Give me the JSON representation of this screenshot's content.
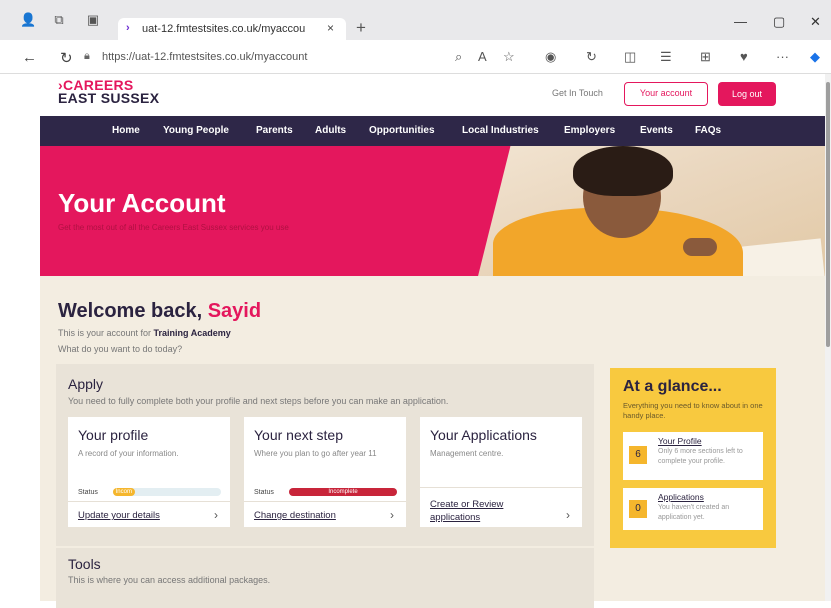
{
  "browser": {
    "tab_title": "uat-12.fmtestsites.co.uk/myaccou",
    "url": "https://uat-12.fmtestsites.co.uk/myaccount",
    "new_tab_glyph": "+",
    "close_glyph": "×",
    "minimize_glyph": "—",
    "restore_glyph": "▢",
    "window_close_glyph": "✕",
    "back_glyph": "←",
    "refresh_glyph": "↻",
    "more_glyph": "···"
  },
  "header": {
    "logo_line1": "›CAREERS",
    "logo_line2": "EAST SUSSEX",
    "get_in_touch": "Get In Touch",
    "your_account": "Your account",
    "log_out": "Log out"
  },
  "nav": {
    "items": [
      "Home",
      "Young People",
      "Parents",
      "Adults",
      "Opportunities",
      "Local Industries",
      "Employers",
      "Events",
      "FAQs"
    ]
  },
  "hero": {
    "title": "Your Account",
    "subtitle": "Get the most out of all the Careers East Sussex services you use"
  },
  "welcome": {
    "prefix": "Welcome back, ",
    "name": "Sayid",
    "account_prefix": "This is your account for ",
    "account_org": "Training Academy",
    "question": "What do you want to do today?"
  },
  "apply": {
    "title": "Apply",
    "description": "You need to fully complete both your profile and next steps before you can make an application.",
    "cards": [
      {
        "title": "Your profile",
        "description": "A record of your information.",
        "status_label": "Status",
        "status_text": "Incom",
        "status_fill": 0.2,
        "status_color": "#f5b62d",
        "link": "Update your details"
      },
      {
        "title": "Your next step",
        "description": "Where you plan to go after year 11",
        "status_label": "Status",
        "status_text": "Incomplete",
        "status_fill": 1.0,
        "status_color": "#c8253a",
        "link": "Change destination"
      },
      {
        "title": "Your Applications",
        "description": "Management centre.",
        "link": "Create or Review applications"
      }
    ]
  },
  "tools": {
    "title": "Tools",
    "description": "This is where you can access additional packages."
  },
  "glance": {
    "title": "At a glance...",
    "description": "Everything you need to know about in one handy place.",
    "items": [
      {
        "count": "6",
        "title": "Your Profile",
        "description": "Only 6 more sections left to complete your profile."
      },
      {
        "count": "0",
        "title": "Applications",
        "description": "You haven't created an application yet."
      }
    ]
  },
  "colors": {
    "brand_pink": "#e4175d",
    "nav_dark": "#2e2748",
    "glance_yellow": "#f8c93f",
    "content_bg": "#f3ede1"
  }
}
